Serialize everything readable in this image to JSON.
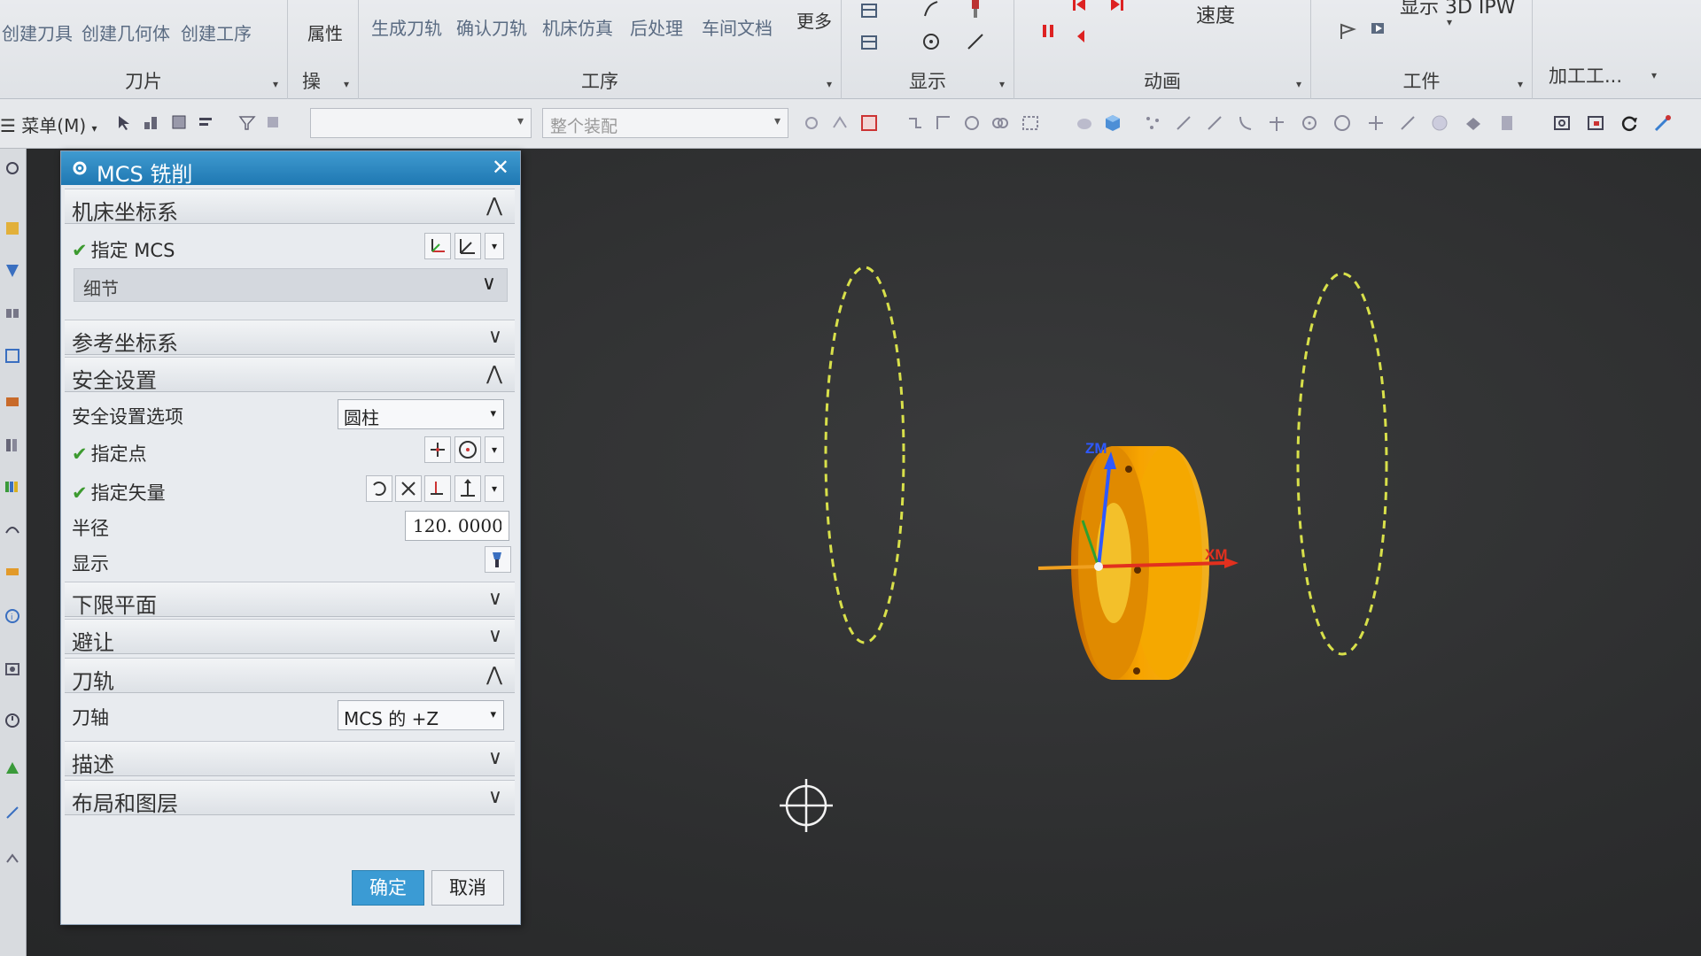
{
  "ribbon": {
    "group_blade": {
      "name": "刀片",
      "buttons": [
        "创建刀具",
        "创建几何体",
        "创建工序"
      ]
    },
    "group_props": {
      "name": "属性",
      "sub": "操"
    },
    "group_op": {
      "name": "工序",
      "buttons": [
        "生成刀轨",
        "确认刀轨",
        "机床仿真",
        "后处理",
        "车间文档",
        "更多"
      ]
    },
    "group_display": {
      "name": "显示"
    },
    "group_anim": {
      "name": "动画",
      "speed_label": "速度"
    },
    "group_workpiece": {
      "name": "工件",
      "top_label": "显示 3D IPW"
    },
    "group_machining": {
      "name": "加工工..."
    }
  },
  "toolbar": {
    "menu_label": "菜单(M)",
    "filter_placeholder": "",
    "assembly_select": "整个装配"
  },
  "dialog": {
    "title": "MCS 铣削",
    "sections": {
      "machine_cs": "机床坐标系",
      "specify_mcs": "指定 MCS",
      "details": "细节",
      "ref_cs": "参考坐标系",
      "safe_settings": "安全设置",
      "safe_option_label": "安全设置选项",
      "safe_option_value": "圆柱",
      "specify_point": "指定点",
      "specify_vector": "指定矢量",
      "radius_label": "半径",
      "radius_value": "120. 0000",
      "display_label": "显示",
      "lower_plane": "下限平面",
      "avoidance": "避让",
      "tool_axis_section": "刀轨",
      "tool_axis_label": "刀轴",
      "tool_axis_value": "MCS 的 +Z",
      "description": "描述",
      "layout_layers": "布局和图层"
    },
    "ok_label": "确定",
    "cancel_label": "取消"
  },
  "viewport": {
    "x_axis_label": "XM",
    "z_axis_label": "ZM",
    "part_color": "#f0a000",
    "safe_cylinder_color": "#d8e04a"
  },
  "colors": {
    "title_bar": "#2585c0",
    "ok_button": "#3b9bd4",
    "check": "#3c9a2f"
  }
}
